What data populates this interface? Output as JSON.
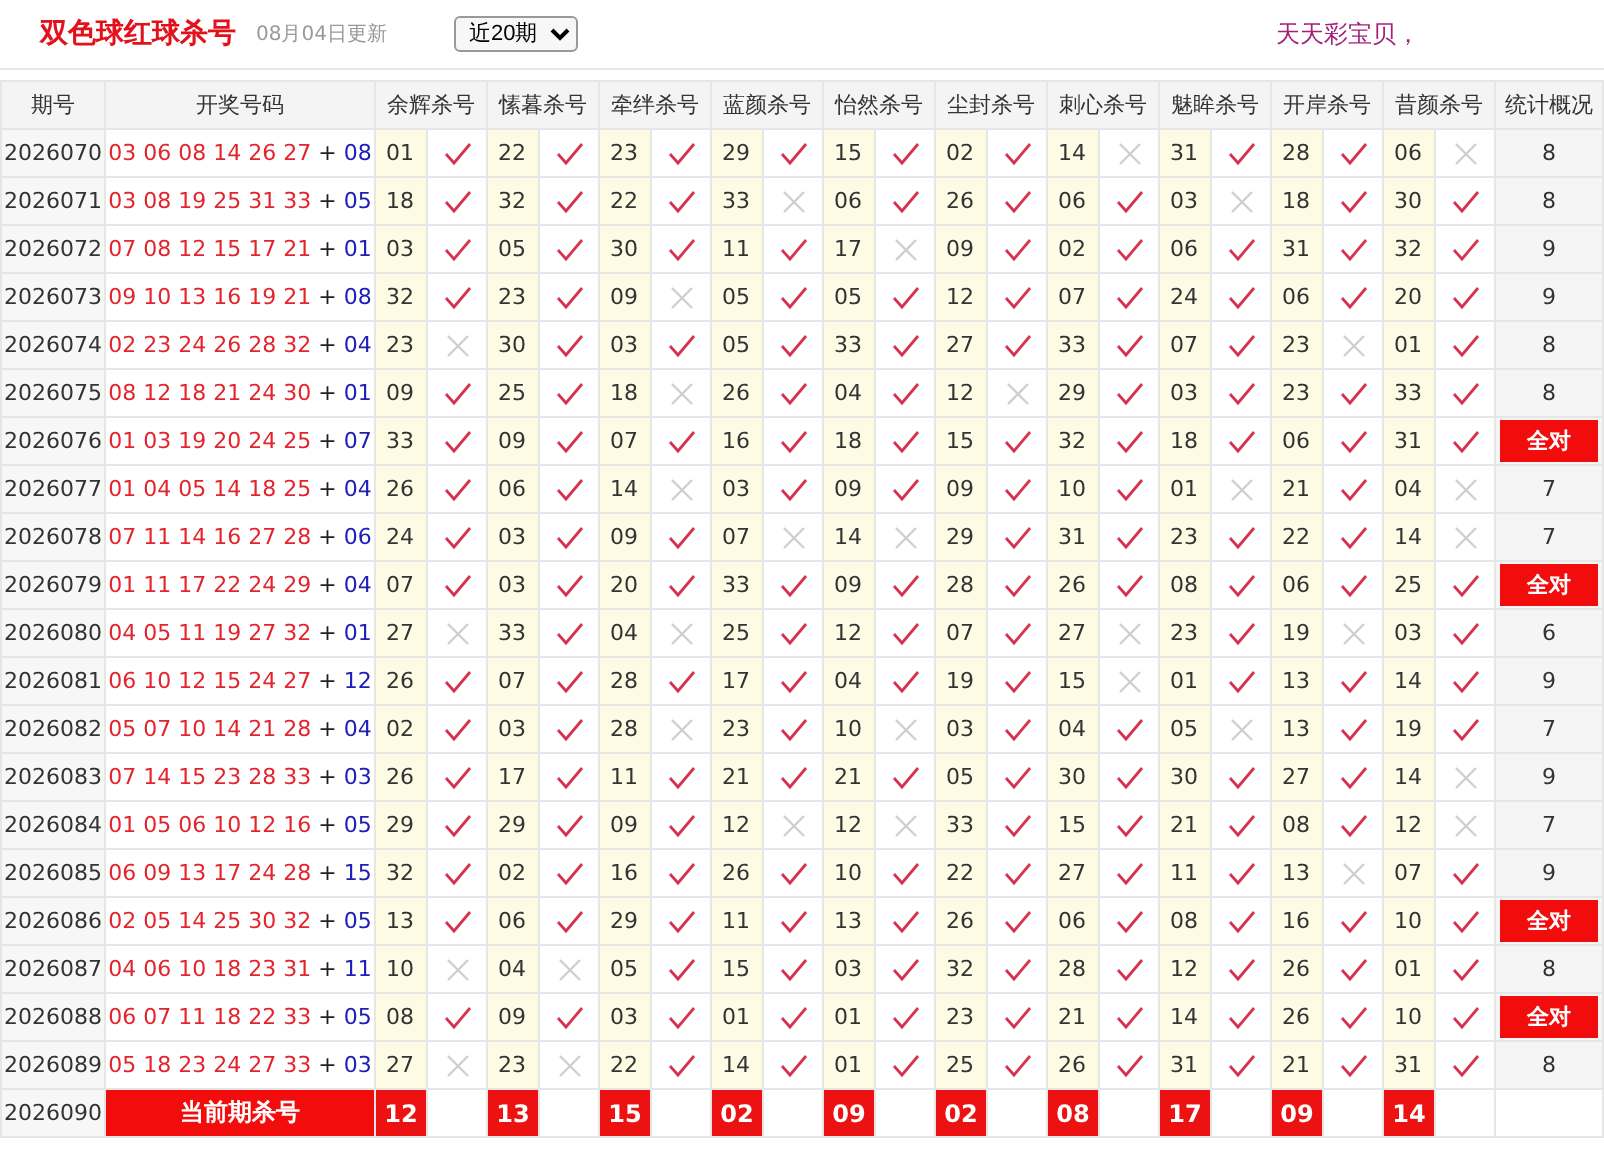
{
  "header": {
    "title": "双色球红球杀号",
    "updated": "08月04日更新",
    "period_select": "近20期",
    "slogan": "天天彩宝贝，"
  },
  "table": {
    "columns": [
      "期号",
      "开奖号码",
      "余辉杀号",
      "愫暮杀号",
      "牵绊杀号",
      "蓝颜杀号",
      "怡然杀号",
      "尘封杀号",
      "刺心杀号",
      "魅眸杀号",
      "开岸杀号",
      "昔颜杀号",
      "统计概况"
    ],
    "rows": [
      {
        "issue": "2026070",
        "reds": "03 06 08 14 26 27",
        "plus": "+",
        "blue": "08",
        "kills": [
          "01",
          "22",
          "23",
          "29",
          "15",
          "02",
          "14",
          "31",
          "28",
          "06"
        ],
        "hits": [
          true,
          true,
          true,
          true,
          true,
          true,
          false,
          true,
          true,
          false
        ],
        "stat": "8",
        "all_correct": false
      },
      {
        "issue": "2026071",
        "reds": "03 08 19 25 31 33",
        "plus": "+",
        "blue": "05",
        "kills": [
          "18",
          "32",
          "22",
          "33",
          "06",
          "26",
          "06",
          "03",
          "18",
          "30"
        ],
        "hits": [
          true,
          true,
          true,
          false,
          true,
          true,
          true,
          false,
          true,
          true
        ],
        "stat": "8",
        "all_correct": false
      },
      {
        "issue": "2026072",
        "reds": "07 08 12 15 17 21",
        "plus": "+",
        "blue": "01",
        "kills": [
          "03",
          "05",
          "30",
          "11",
          "17",
          "09",
          "02",
          "06",
          "31",
          "32"
        ],
        "hits": [
          true,
          true,
          true,
          true,
          false,
          true,
          true,
          true,
          true,
          true
        ],
        "stat": "9",
        "all_correct": false
      },
      {
        "issue": "2026073",
        "reds": "09 10 13 16 19 21",
        "plus": "+",
        "blue": "08",
        "kills": [
          "32",
          "23",
          "09",
          "05",
          "05",
          "12",
          "07",
          "24",
          "06",
          "20"
        ],
        "hits": [
          true,
          true,
          false,
          true,
          true,
          true,
          true,
          true,
          true,
          true
        ],
        "stat": "9",
        "all_correct": false
      },
      {
        "issue": "2026074",
        "reds": "02 23 24 26 28 32",
        "plus": "+",
        "blue": "04",
        "kills": [
          "23",
          "30",
          "03",
          "05",
          "33",
          "27",
          "33",
          "07",
          "23",
          "01"
        ],
        "hits": [
          false,
          true,
          true,
          true,
          true,
          true,
          true,
          true,
          false,
          true
        ],
        "stat": "8",
        "all_correct": false
      },
      {
        "issue": "2026075",
        "reds": "08 12 18 21 24 30",
        "plus": "+",
        "blue": "01",
        "kills": [
          "09",
          "25",
          "18",
          "26",
          "04",
          "12",
          "29",
          "03",
          "23",
          "33"
        ],
        "hits": [
          true,
          true,
          false,
          true,
          true,
          false,
          true,
          true,
          true,
          true
        ],
        "stat": "8",
        "all_correct": false
      },
      {
        "issue": "2026076",
        "reds": "01 03 19 20 24 25",
        "plus": "+",
        "blue": "07",
        "kills": [
          "33",
          "09",
          "07",
          "16",
          "18",
          "15",
          "32",
          "18",
          "06",
          "31"
        ],
        "hits": [
          true,
          true,
          true,
          true,
          true,
          true,
          true,
          true,
          true,
          true
        ],
        "stat": "全对",
        "all_correct": true
      },
      {
        "issue": "2026077",
        "reds": "01 04 05 14 18 25",
        "plus": "+",
        "blue": "04",
        "kills": [
          "26",
          "06",
          "14",
          "03",
          "09",
          "09",
          "10",
          "01",
          "21",
          "04"
        ],
        "hits": [
          true,
          true,
          false,
          true,
          true,
          true,
          true,
          false,
          true,
          false
        ],
        "stat": "7",
        "all_correct": false
      },
      {
        "issue": "2026078",
        "reds": "07 11 14 16 27 28",
        "plus": "+",
        "blue": "06",
        "kills": [
          "24",
          "03",
          "09",
          "07",
          "14",
          "29",
          "31",
          "23",
          "22",
          "14"
        ],
        "hits": [
          true,
          true,
          true,
          false,
          false,
          true,
          true,
          true,
          true,
          false
        ],
        "stat": "7",
        "all_correct": false
      },
      {
        "issue": "2026079",
        "reds": "01 11 17 22 24 29",
        "plus": "+",
        "blue": "04",
        "kills": [
          "07",
          "03",
          "20",
          "33",
          "09",
          "28",
          "26",
          "08",
          "06",
          "25"
        ],
        "hits": [
          true,
          true,
          true,
          true,
          true,
          true,
          true,
          true,
          true,
          true
        ],
        "stat": "全对",
        "all_correct": true
      },
      {
        "issue": "2026080",
        "reds": "04 05 11 19 27 32",
        "plus": "+",
        "blue": "01",
        "kills": [
          "27",
          "33",
          "04",
          "25",
          "12",
          "07",
          "27",
          "23",
          "19",
          "03"
        ],
        "hits": [
          false,
          true,
          false,
          true,
          true,
          true,
          false,
          true,
          false,
          true
        ],
        "stat": "6",
        "all_correct": false
      },
      {
        "issue": "2026081",
        "reds": "06 10 12 15 24 27",
        "plus": "+",
        "blue": "12",
        "kills": [
          "26",
          "07",
          "28",
          "17",
          "04",
          "19",
          "15",
          "01",
          "13",
          "14"
        ],
        "hits": [
          true,
          true,
          true,
          true,
          true,
          true,
          false,
          true,
          true,
          true
        ],
        "stat": "9",
        "all_correct": false
      },
      {
        "issue": "2026082",
        "reds": "05 07 10 14 21 28",
        "plus": "+",
        "blue": "04",
        "kills": [
          "02",
          "03",
          "28",
          "23",
          "10",
          "03",
          "04",
          "05",
          "13",
          "19"
        ],
        "hits": [
          true,
          true,
          false,
          true,
          false,
          true,
          true,
          false,
          true,
          true
        ],
        "stat": "7",
        "all_correct": false
      },
      {
        "issue": "2026083",
        "reds": "07 14 15 23 28 33",
        "plus": "+",
        "blue": "03",
        "kills": [
          "26",
          "17",
          "11",
          "21",
          "21",
          "05",
          "30",
          "30",
          "27",
          "14"
        ],
        "hits": [
          true,
          true,
          true,
          true,
          true,
          true,
          true,
          true,
          true,
          false
        ],
        "stat": "9",
        "all_correct": false
      },
      {
        "issue": "2026084",
        "reds": "01 05 06 10 12 16",
        "plus": "+",
        "blue": "05",
        "kills": [
          "29",
          "29",
          "09",
          "12",
          "12",
          "33",
          "15",
          "21",
          "08",
          "12"
        ],
        "hits": [
          true,
          true,
          true,
          false,
          false,
          true,
          true,
          true,
          true,
          false
        ],
        "stat": "7",
        "all_correct": false
      },
      {
        "issue": "2026085",
        "reds": "06 09 13 17 24 28",
        "plus": "+",
        "blue": "15",
        "kills": [
          "32",
          "02",
          "16",
          "26",
          "10",
          "22",
          "27",
          "11",
          "13",
          "07"
        ],
        "hits": [
          true,
          true,
          true,
          true,
          true,
          true,
          true,
          true,
          false,
          true
        ],
        "stat": "9",
        "all_correct": false
      },
      {
        "issue": "2026086",
        "reds": "02 05 14 25 30 32",
        "plus": "+",
        "blue": "05",
        "kills": [
          "13",
          "06",
          "29",
          "11",
          "13",
          "26",
          "06",
          "08",
          "16",
          "10"
        ],
        "hits": [
          true,
          true,
          true,
          true,
          true,
          true,
          true,
          true,
          true,
          true
        ],
        "stat": "全对",
        "all_correct": true
      },
      {
        "issue": "2026087",
        "reds": "04 06 10 18 23 31",
        "plus": "+",
        "blue": "11",
        "kills": [
          "10",
          "04",
          "05",
          "15",
          "03",
          "32",
          "28",
          "12",
          "26",
          "01"
        ],
        "hits": [
          false,
          false,
          true,
          true,
          true,
          true,
          true,
          true,
          true,
          true
        ],
        "stat": "8",
        "all_correct": false
      },
      {
        "issue": "2026088",
        "reds": "06 07 11 18 22 33",
        "plus": "+",
        "blue": "05",
        "kills": [
          "08",
          "09",
          "03",
          "01",
          "01",
          "23",
          "21",
          "14",
          "26",
          "10"
        ],
        "hits": [
          true,
          true,
          true,
          true,
          true,
          true,
          true,
          true,
          true,
          true
        ],
        "stat": "全对",
        "all_correct": true
      },
      {
        "issue": "2026089",
        "reds": "05 18 23 24 27 33",
        "plus": "+",
        "blue": "03",
        "kills": [
          "27",
          "23",
          "22",
          "14",
          "01",
          "25",
          "26",
          "31",
          "21",
          "31"
        ],
        "hits": [
          false,
          false,
          true,
          true,
          true,
          true,
          true,
          true,
          true,
          true
        ],
        "stat": "8",
        "all_correct": false
      }
    ],
    "current": {
      "issue": "2026090",
      "label": "当前期杀号",
      "kills": [
        "12",
        "13",
        "15",
        "02",
        "09",
        "02",
        "08",
        "17",
        "09",
        "14"
      ]
    }
  }
}
